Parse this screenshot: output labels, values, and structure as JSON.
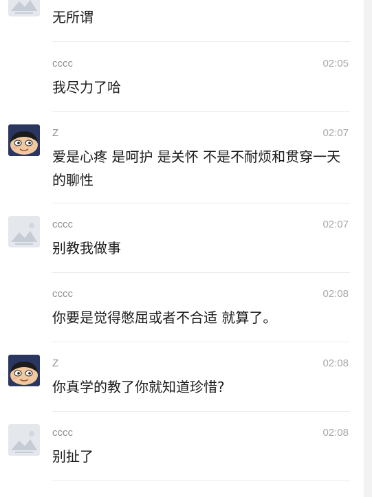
{
  "messages": [
    {
      "sender": "",
      "time": "",
      "text": "无所谓",
      "avatar": "landscape-placeholder"
    },
    {
      "sender": "cccc",
      "time": "02:05",
      "text": "我尽力了哈",
      "avatar": "none"
    },
    {
      "sender": "Z",
      "time": "02:07",
      "text": "爱是心疼 是呵护 是关怀 不是不耐烦和贯穿一天的聊性",
      "avatar": "cartoon-boy"
    },
    {
      "sender": "cccc",
      "time": "02:07",
      "text": "别教我做事",
      "avatar": "landscape-placeholder"
    },
    {
      "sender": "cccc",
      "time": "02:08",
      "text": "你要是觉得憋屈或者不合适 就算了。",
      "avatar": "none"
    },
    {
      "sender": "Z",
      "time": "02:08",
      "text": "你真学的教了你就知道珍惜?",
      "avatar": "cartoon-boy"
    },
    {
      "sender": "cccc",
      "time": "02:08",
      "text": "别扯了",
      "avatar": "landscape-placeholder"
    }
  ],
  "colors": {
    "text": "#1a1a1a",
    "sender": "#8f8f8f",
    "time": "#a8a8a8",
    "divider": "#ebebeb",
    "background": "#ffffff"
  }
}
